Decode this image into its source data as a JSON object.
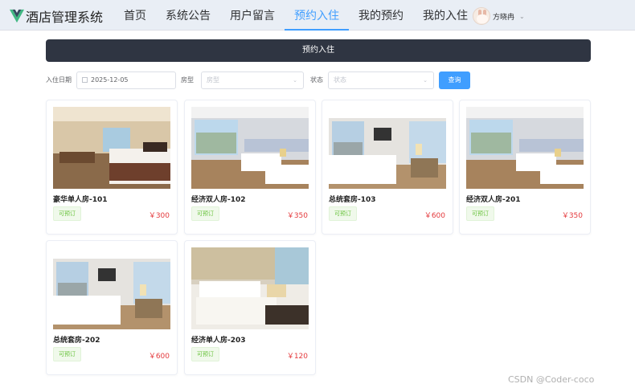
{
  "app": {
    "title": "酒店管理系统"
  },
  "nav": [
    {
      "label": "首页"
    },
    {
      "label": "系统公告"
    },
    {
      "label": "用户留言"
    },
    {
      "label": "预约入住",
      "active": true
    },
    {
      "label": "我的预约"
    },
    {
      "label": "我的入住"
    }
  ],
  "user": {
    "name": "方晓冉"
  },
  "banner": {
    "title": "预约入住"
  },
  "filters": {
    "checkin_label": "入住日期",
    "checkin_value": "2025-12-05",
    "roomtype_label": "房型",
    "roomtype_placeholder": "房型",
    "status_label": "状态",
    "status_placeholder": "状态",
    "search_label": "查询"
  },
  "rooms": [
    {
      "name": "豪华单人房-101",
      "status": "可预订",
      "price": "￥300",
      "photo": "single-warm"
    },
    {
      "name": "经济双人房-102",
      "status": "可预订",
      "price": "￥350",
      "photo": "twin"
    },
    {
      "name": "总统套房-103",
      "status": "可预订",
      "price": "￥600",
      "photo": "suite"
    },
    {
      "name": "经济双人房-201",
      "status": "可预订",
      "price": "￥350",
      "photo": "twin"
    },
    {
      "name": "总统套房-202",
      "status": "可预订",
      "price": "￥600",
      "photo": "suite"
    },
    {
      "name": "经济单人房-203",
      "status": "可预订",
      "price": "￥120",
      "photo": "single-bright"
    }
  ],
  "colors": {
    "accent": "#409eff",
    "banner": "#2f3542",
    "price": "#e4393c",
    "available": "#67c23a"
  },
  "watermark": "CSDN @Coder-coco"
}
